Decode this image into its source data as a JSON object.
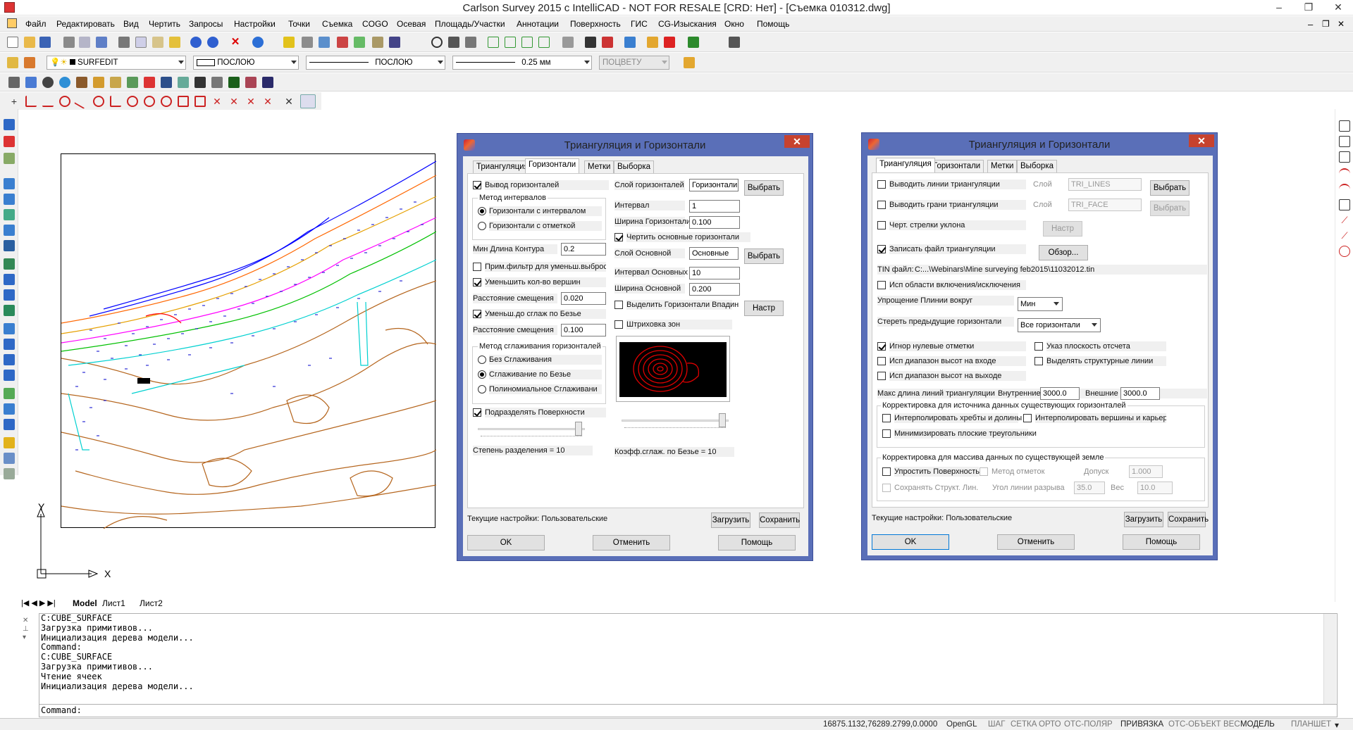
{
  "window": {
    "title": "Carlson Survey 2015 с IntelliCAD - NOT FOR RESALE [CRD: Нет] - [Съемка 010312.dwg]"
  },
  "menu": [
    "Файл",
    "Редактировать",
    "Вид",
    "Чертить",
    "Запросы",
    "Настройки",
    "Точки",
    "Съемка",
    "COGO",
    "Осевая",
    "Площадь/Участки",
    "Аннотации",
    "Поверхность",
    "ГИС",
    "CG-Изыскания",
    "Окно",
    "Помощь"
  ],
  "toolbar2": {
    "layer": "SURFEDIT",
    "linetype_combo": "ПОСЛОЮ",
    "linetype_combo2": "ПОСЛОЮ",
    "lineweight": "0.25 мм",
    "color": "ПОЦВЕТУ"
  },
  "axis": {
    "x": "X",
    "y": "Y"
  },
  "layout_tabs": [
    "Model",
    "Лист1",
    "Лист2"
  ],
  "command_history": [
    "C:CUBE_SURFACE",
    "Загрузка примитивов...",
    "Инициализация дерева модели...",
    "Command:",
    "C:CUBE_SURFACE",
    "Загрузка примитивов...",
    "Чтение ячеек",
    "Инициализация дерева модели..."
  ],
  "command_prompt": "Command:",
  "status": {
    "coords": "16875.1132,76289.2799,0.0000",
    "items": [
      "OpenGL",
      "ШАГ",
      "СЕТКА",
      "ОРТО",
      "ОТС-ПОЛЯР",
      "ПРИВЯЗКА",
      "ОТС-ОБЪЕКТ",
      "ВЕС",
      "МОДЕЛЬ",
      "ПЛАНШЕТ"
    ]
  },
  "dialog1": {
    "title": "Триангуляция и Горизонтали",
    "tabs": [
      "Триангуляция",
      "Горизонтали",
      "Метки",
      "Выборка"
    ],
    "contour_output": "Вывод горизонталей",
    "interval_method": "Метод интервалов",
    "radio_interval": "Горизонтали с интервалом",
    "radio_elevation": "Горизонтали с  отметкой",
    "min_length_label": "Мин Длина Контура",
    "min_length": "0.2",
    "filter_label": "Прим.фильтр для уменьш.выброс",
    "reduce_vertices": "Уменьшить кол-во вершин",
    "offset_label": "Расстояние смещения",
    "offset1": "0.020",
    "bezier_reduce": "Уменьш.до сглаж по Безье",
    "offset2": "0.100",
    "smooth_method": "Метод сглаживания горизонталей",
    "no_smooth": "Без Сглаживания",
    "bezier_smooth": "Сглаживание по Безье",
    "poly_smooth": "Полиномиальное Сглаживани",
    "subdivide": "Подразделять Поверхности",
    "subdiv_degree": "Степень разделения = 10",
    "layer_label": "Слой горизонталей",
    "layer_value": "Горизонтали",
    "choose": "Выбрать",
    "interval_label": "Интервал",
    "interval_value": "1",
    "width_label": "Ширина Горизонтали",
    "width_value": "0.100",
    "draw_main": "Чертить основные горизонтали",
    "main_layer_label": "Слой Основной",
    "main_layer_value": "Основные",
    "main_interval_label": "Интервал Основных",
    "main_interval_value": "10",
    "main_width_label": "Ширина Основной",
    "main_width_value": "0.200",
    "highlight_low": "Выделить Горизонтали Впадин",
    "setup_btn": "Настр",
    "hatch_zones": "Штриховка зон",
    "bezier_coef": "Коэфф.сглаж. по Безье = 10",
    "current_settings": "Текущие настройки: Пользовательские",
    "load": "Загрузить",
    "save": "Сохранить",
    "ok": "OK",
    "cancel": "Отменить",
    "help": "Помощь"
  },
  "dialog2": {
    "title": "Триангуляция и Горизонтали",
    "tabs": [
      "Триангуляция",
      "Горизонтали",
      "Метки",
      "Выборка"
    ],
    "out_lines": "Выводить линии триангуляции",
    "layer_word": "Слой",
    "lines_layer": "TRI_LINES",
    "out_faces": "Выводить грани триангуляции",
    "faces_layer": "TRI_FACE",
    "choose": "Выбрать",
    "slope_arrows": "Черт. стрелки уклона",
    "setup": "Настр",
    "write_file": "Записать файл триангуляции",
    "browse": "Обзор...",
    "tin_label": "TIN файл:",
    "tin_path": "C:...\\Webinars\\Mine surveying feb2015\\11032012.tin",
    "incl_excl": "Исп области включения/исключения",
    "simplify_label": "Упрощение Плинии вокруг",
    "simplify_value": "Мин",
    "erase_label": "Стереть предыдущие горизонтали",
    "erase_value": "Все горизонтали",
    "ignore_zero": "Игнор нулевые отметки",
    "ref_plane": "Указ плоскость отсчета",
    "input_range": "Исп диапазон высот на входе",
    "struct_lines": "Выделять структурные линии",
    "output_range": "Исп диапазон высот на выходе",
    "max_len": "Макс длина линий триангуляции",
    "inner": "Внутренние",
    "inner_v": "3000.0",
    "outer": "Внешние",
    "outer_v": "3000.0",
    "grp1": "Корректировка для источника данных существующих горизонталей",
    "interp_ridges": "Интерполировать хребты и долины",
    "interp_peaks": "Интерполировать вершины и карьер",
    "min_flat": "Минимизировать плоские треугольники",
    "grp2": "Корректировка для массива данных по существующей земле",
    "simplify_surface": "Упростить Поверхность",
    "method_marks": "Метод отметок",
    "tolerance": "Допуск",
    "tol_v": "1.000",
    "keep_struct": "Сохранять Структ. Лин.",
    "break_angle": "Угол линии разрыва",
    "angle_v": "35.0",
    "weight": "Вес",
    "weight_v": "10.0",
    "current_settings": "Текущие настройки: Пользовательские",
    "load": "Загрузить",
    "save": "Сохранить",
    "ok": "OK",
    "cancel": "Отменить",
    "help": "Помощь"
  },
  "colors": {
    "dialog_frame": "#5a6fb8",
    "close": "#c7422e",
    "contour_brown": "#b5651d",
    "contour_red": "#e00000"
  }
}
